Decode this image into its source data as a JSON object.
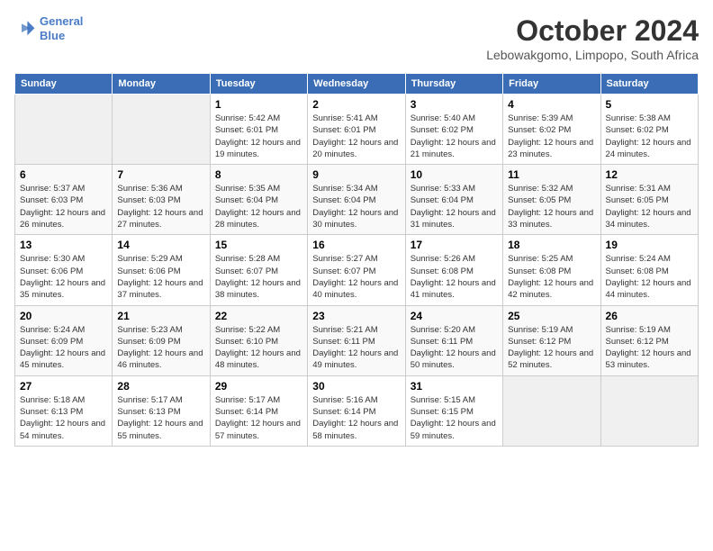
{
  "header": {
    "logo_line1": "General",
    "logo_line2": "Blue",
    "month": "October 2024",
    "location": "Lebowakgomo, Limpopo, South Africa"
  },
  "days_of_week": [
    "Sunday",
    "Monday",
    "Tuesday",
    "Wednesday",
    "Thursday",
    "Friday",
    "Saturday"
  ],
  "weeks": [
    [
      {
        "day": "",
        "empty": true
      },
      {
        "day": "",
        "empty": true
      },
      {
        "day": "1",
        "sunrise": "Sunrise: 5:42 AM",
        "sunset": "Sunset: 6:01 PM",
        "daylight": "Daylight: 12 hours and 19 minutes."
      },
      {
        "day": "2",
        "sunrise": "Sunrise: 5:41 AM",
        "sunset": "Sunset: 6:01 PM",
        "daylight": "Daylight: 12 hours and 20 minutes."
      },
      {
        "day": "3",
        "sunrise": "Sunrise: 5:40 AM",
        "sunset": "Sunset: 6:02 PM",
        "daylight": "Daylight: 12 hours and 21 minutes."
      },
      {
        "day": "4",
        "sunrise": "Sunrise: 5:39 AM",
        "sunset": "Sunset: 6:02 PM",
        "daylight": "Daylight: 12 hours and 23 minutes."
      },
      {
        "day": "5",
        "sunrise": "Sunrise: 5:38 AM",
        "sunset": "Sunset: 6:02 PM",
        "daylight": "Daylight: 12 hours and 24 minutes."
      }
    ],
    [
      {
        "day": "6",
        "sunrise": "Sunrise: 5:37 AM",
        "sunset": "Sunset: 6:03 PM",
        "daylight": "Daylight: 12 hours and 26 minutes."
      },
      {
        "day": "7",
        "sunrise": "Sunrise: 5:36 AM",
        "sunset": "Sunset: 6:03 PM",
        "daylight": "Daylight: 12 hours and 27 minutes."
      },
      {
        "day": "8",
        "sunrise": "Sunrise: 5:35 AM",
        "sunset": "Sunset: 6:04 PM",
        "daylight": "Daylight: 12 hours and 28 minutes."
      },
      {
        "day": "9",
        "sunrise": "Sunrise: 5:34 AM",
        "sunset": "Sunset: 6:04 PM",
        "daylight": "Daylight: 12 hours and 30 minutes."
      },
      {
        "day": "10",
        "sunrise": "Sunrise: 5:33 AM",
        "sunset": "Sunset: 6:04 PM",
        "daylight": "Daylight: 12 hours and 31 minutes."
      },
      {
        "day": "11",
        "sunrise": "Sunrise: 5:32 AM",
        "sunset": "Sunset: 6:05 PM",
        "daylight": "Daylight: 12 hours and 33 minutes."
      },
      {
        "day": "12",
        "sunrise": "Sunrise: 5:31 AM",
        "sunset": "Sunset: 6:05 PM",
        "daylight": "Daylight: 12 hours and 34 minutes."
      }
    ],
    [
      {
        "day": "13",
        "sunrise": "Sunrise: 5:30 AM",
        "sunset": "Sunset: 6:06 PM",
        "daylight": "Daylight: 12 hours and 35 minutes."
      },
      {
        "day": "14",
        "sunrise": "Sunrise: 5:29 AM",
        "sunset": "Sunset: 6:06 PM",
        "daylight": "Daylight: 12 hours and 37 minutes."
      },
      {
        "day": "15",
        "sunrise": "Sunrise: 5:28 AM",
        "sunset": "Sunset: 6:07 PM",
        "daylight": "Daylight: 12 hours and 38 minutes."
      },
      {
        "day": "16",
        "sunrise": "Sunrise: 5:27 AM",
        "sunset": "Sunset: 6:07 PM",
        "daylight": "Daylight: 12 hours and 40 minutes."
      },
      {
        "day": "17",
        "sunrise": "Sunrise: 5:26 AM",
        "sunset": "Sunset: 6:08 PM",
        "daylight": "Daylight: 12 hours and 41 minutes."
      },
      {
        "day": "18",
        "sunrise": "Sunrise: 5:25 AM",
        "sunset": "Sunset: 6:08 PM",
        "daylight": "Daylight: 12 hours and 42 minutes."
      },
      {
        "day": "19",
        "sunrise": "Sunrise: 5:24 AM",
        "sunset": "Sunset: 6:08 PM",
        "daylight": "Daylight: 12 hours and 44 minutes."
      }
    ],
    [
      {
        "day": "20",
        "sunrise": "Sunrise: 5:24 AM",
        "sunset": "Sunset: 6:09 PM",
        "daylight": "Daylight: 12 hours and 45 minutes."
      },
      {
        "day": "21",
        "sunrise": "Sunrise: 5:23 AM",
        "sunset": "Sunset: 6:09 PM",
        "daylight": "Daylight: 12 hours and 46 minutes."
      },
      {
        "day": "22",
        "sunrise": "Sunrise: 5:22 AM",
        "sunset": "Sunset: 6:10 PM",
        "daylight": "Daylight: 12 hours and 48 minutes."
      },
      {
        "day": "23",
        "sunrise": "Sunrise: 5:21 AM",
        "sunset": "Sunset: 6:11 PM",
        "daylight": "Daylight: 12 hours and 49 minutes."
      },
      {
        "day": "24",
        "sunrise": "Sunrise: 5:20 AM",
        "sunset": "Sunset: 6:11 PM",
        "daylight": "Daylight: 12 hours and 50 minutes."
      },
      {
        "day": "25",
        "sunrise": "Sunrise: 5:19 AM",
        "sunset": "Sunset: 6:12 PM",
        "daylight": "Daylight: 12 hours and 52 minutes."
      },
      {
        "day": "26",
        "sunrise": "Sunrise: 5:19 AM",
        "sunset": "Sunset: 6:12 PM",
        "daylight": "Daylight: 12 hours and 53 minutes."
      }
    ],
    [
      {
        "day": "27",
        "sunrise": "Sunrise: 5:18 AM",
        "sunset": "Sunset: 6:13 PM",
        "daylight": "Daylight: 12 hours and 54 minutes."
      },
      {
        "day": "28",
        "sunrise": "Sunrise: 5:17 AM",
        "sunset": "Sunset: 6:13 PM",
        "daylight": "Daylight: 12 hours and 55 minutes."
      },
      {
        "day": "29",
        "sunrise": "Sunrise: 5:17 AM",
        "sunset": "Sunset: 6:14 PM",
        "daylight": "Daylight: 12 hours and 57 minutes."
      },
      {
        "day": "30",
        "sunrise": "Sunrise: 5:16 AM",
        "sunset": "Sunset: 6:14 PM",
        "daylight": "Daylight: 12 hours and 58 minutes."
      },
      {
        "day": "31",
        "sunrise": "Sunrise: 5:15 AM",
        "sunset": "Sunset: 6:15 PM",
        "daylight": "Daylight: 12 hours and 59 minutes."
      },
      {
        "day": "",
        "empty": true
      },
      {
        "day": "",
        "empty": true
      }
    ]
  ]
}
